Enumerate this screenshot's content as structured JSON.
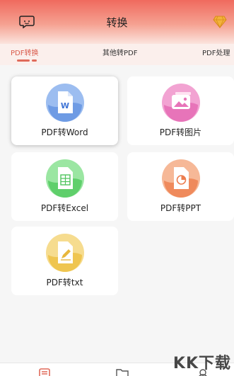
{
  "header": {
    "title": "转换",
    "left_icon": "chat-bubble-icon",
    "right_icon": "vip-diamond-icon"
  },
  "tabs": [
    {
      "label": "PDF转换",
      "active": true
    },
    {
      "label": "其他转PDF",
      "active": false
    },
    {
      "label": "PDF处理",
      "active": false
    }
  ],
  "tools": [
    {
      "label": "PDF转Word",
      "icon": "word-document-icon",
      "color": "#5b8fe0",
      "selected": true
    },
    {
      "label": "PDF转图片",
      "icon": "image-icon",
      "color": "#e05aa8",
      "selected": false
    },
    {
      "label": "PDF转Excel",
      "icon": "excel-sheet-icon",
      "color": "#4fc45e",
      "selected": false
    },
    {
      "label": "PDF转PPT",
      "icon": "ppt-slide-icon",
      "color": "#ec7d4f",
      "selected": false
    },
    {
      "label": "PDF转txt",
      "icon": "text-file-icon",
      "color": "#e8b73c",
      "selected": false
    }
  ],
  "bottom_nav": [
    {
      "icon": "convert-tab-icon"
    },
    {
      "icon": "folder-icon"
    },
    {
      "icon": "profile-icon"
    }
  ],
  "watermark": "KK下载"
}
